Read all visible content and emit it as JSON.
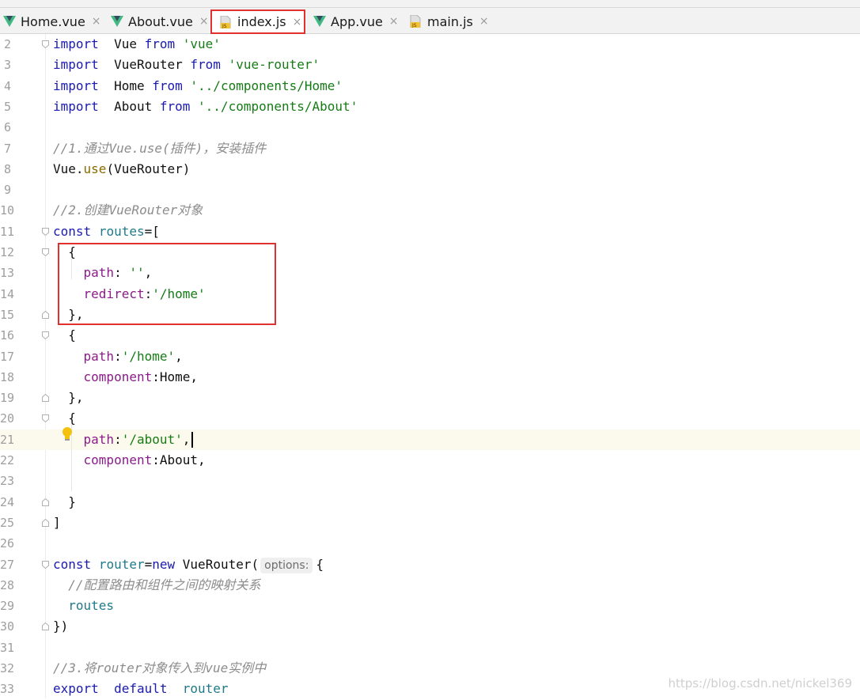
{
  "tabs": [
    {
      "label": "Home.vue",
      "icon": "vue-icon",
      "active": false
    },
    {
      "label": "About.vue",
      "icon": "vue-icon",
      "active": false
    },
    {
      "label": "index.js",
      "icon": "js-file-icon",
      "active": true
    },
    {
      "label": "App.vue",
      "icon": "vue-icon",
      "active": false
    },
    {
      "label": "main.js",
      "icon": "js-file-icon",
      "active": false
    }
  ],
  "close_glyph": "×",
  "js_icon_text": "JS",
  "colors": {
    "highlight_box": "#e03030",
    "keyword": "#1a1ab0",
    "string": "#167c16",
    "property": "#8a1c8a",
    "comment": "#8c8c8c",
    "vue_green": "#41b883"
  },
  "editor": {
    "lines": [
      {
        "num": "2",
        "tokens": [
          [
            "kw",
            "import"
          ],
          [
            "",
            "  Vue "
          ],
          [
            "kw",
            "from"
          ],
          [
            "",
            " "
          ],
          [
            "str",
            "'vue'"
          ]
        ]
      },
      {
        "num": "3",
        "tokens": [
          [
            "kw",
            "import"
          ],
          [
            "",
            "  VueRouter "
          ],
          [
            "kw",
            "from"
          ],
          [
            "",
            " "
          ],
          [
            "str",
            "'vue-router'"
          ]
        ]
      },
      {
        "num": "4",
        "tokens": [
          [
            "kw",
            "import"
          ],
          [
            "",
            "  Home "
          ],
          [
            "kw",
            "from"
          ],
          [
            "",
            " "
          ],
          [
            "str",
            "'../components/Home'"
          ]
        ]
      },
      {
        "num": "5",
        "tokens": [
          [
            "kw",
            "import"
          ],
          [
            "",
            "  About "
          ],
          [
            "kw",
            "from"
          ],
          [
            "",
            " "
          ],
          [
            "str",
            "'../components/About'"
          ]
        ]
      },
      {
        "num": "6",
        "tokens": []
      },
      {
        "num": "7",
        "tokens": [
          [
            "cmt",
            "//1.通过Vue.use(插件)，安装插件"
          ]
        ]
      },
      {
        "num": "8",
        "tokens": [
          [
            "",
            "Vue."
          ],
          [
            "fn",
            "use"
          ],
          [
            "",
            "(VueRouter)"
          ]
        ]
      },
      {
        "num": "9",
        "tokens": []
      },
      {
        "num": "10",
        "tokens": [
          [
            "cmt",
            "//2.创建VueRouter对象"
          ]
        ]
      },
      {
        "num": "11",
        "tokens": [
          [
            "kw",
            "const"
          ],
          [
            "",
            " "
          ],
          [
            "var",
            "routes"
          ],
          [
            "",
            "=["
          ]
        ]
      },
      {
        "num": "12",
        "tokens": [
          [
            "",
            "  {"
          ]
        ]
      },
      {
        "num": "13",
        "tokens": [
          [
            "",
            "    "
          ],
          [
            "prop",
            "path"
          ],
          [
            "",
            ": "
          ],
          [
            "str",
            "''"
          ],
          [
            "",
            ","
          ]
        ]
      },
      {
        "num": "14",
        "tokens": [
          [
            "",
            "    "
          ],
          [
            "prop",
            "redirect"
          ],
          [
            "",
            ":"
          ],
          [
            "str",
            "'/home'"
          ]
        ]
      },
      {
        "num": "15",
        "tokens": [
          [
            "",
            "  },"
          ]
        ]
      },
      {
        "num": "16",
        "tokens": [
          [
            "",
            "  {"
          ]
        ]
      },
      {
        "num": "17",
        "tokens": [
          [
            "",
            "    "
          ],
          [
            "prop",
            "path"
          ],
          [
            "",
            ":"
          ],
          [
            "str",
            "'/home'"
          ],
          [
            "",
            ","
          ]
        ]
      },
      {
        "num": "18",
        "tokens": [
          [
            "",
            "    "
          ],
          [
            "prop",
            "component"
          ],
          [
            "",
            ":Home,"
          ]
        ]
      },
      {
        "num": "19",
        "tokens": [
          [
            "",
            "  },"
          ]
        ]
      },
      {
        "num": "20",
        "tokens": [
          [
            "",
            "  {"
          ]
        ]
      },
      {
        "num": "21",
        "tokens": [
          [
            "",
            "    "
          ],
          [
            "prop",
            "path"
          ],
          [
            "",
            ":"
          ],
          [
            "str",
            "'/about'"
          ],
          [
            "",
            ","
          ]
        ],
        "current": true
      },
      {
        "num": "22",
        "tokens": [
          [
            "",
            "    "
          ],
          [
            "prop",
            "component"
          ],
          [
            "",
            ":About,"
          ]
        ]
      },
      {
        "num": "23",
        "tokens": []
      },
      {
        "num": "24",
        "tokens": [
          [
            "",
            "  }"
          ]
        ]
      },
      {
        "num": "25",
        "tokens": [
          [
            "",
            "]"
          ]
        ]
      },
      {
        "num": "26",
        "tokens": []
      },
      {
        "num": "27",
        "tokens": [
          [
            "kw",
            "const"
          ],
          [
            "",
            " "
          ],
          [
            "var",
            "router"
          ],
          [
            "",
            "="
          ],
          [
            "kw",
            "new"
          ],
          [
            "",
            " VueRouter("
          ],
          [
            "hint",
            "options:"
          ],
          [
            "",
            "{"
          ]
        ]
      },
      {
        "num": "28",
        "tokens": [
          [
            "",
            "  "
          ],
          [
            "cmt",
            "//配置路由和组件之间的映射关系"
          ]
        ]
      },
      {
        "num": "29",
        "tokens": [
          [
            "",
            "  "
          ],
          [
            "var",
            "routes"
          ]
        ]
      },
      {
        "num": "30",
        "tokens": [
          [
            "",
            "})"
          ]
        ]
      },
      {
        "num": "31",
        "tokens": []
      },
      {
        "num": "32",
        "tokens": [
          [
            "cmt",
            "//3.将router对象传入到vue实例中"
          ]
        ]
      },
      {
        "num": "33",
        "tokens": [
          [
            "kw",
            "export"
          ],
          [
            "",
            "  "
          ],
          [
            "kw",
            "default"
          ],
          [
            "",
            "  "
          ],
          [
            "var",
            "router"
          ]
        ]
      }
    ]
  },
  "watermark": "https://blog.csdn.net/nickel369"
}
